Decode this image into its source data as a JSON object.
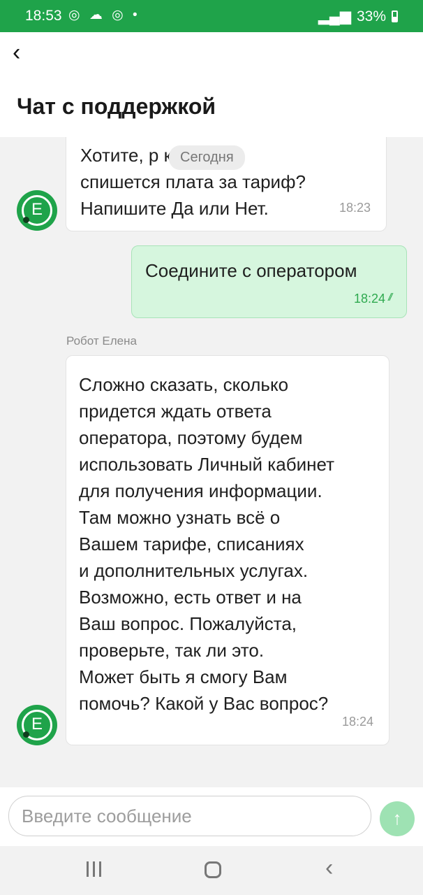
{
  "status_bar": {
    "time": "18:53",
    "left_icons": "◎ ☁ ◎ •",
    "right_text": "33%"
  },
  "header": {
    "title": "Чат с поддержкой"
  },
  "chat": {
    "date_chip": "Сегодня",
    "messages": [
      {
        "direction": "in",
        "text": "Хотите, р          когда\nспишется плата за тариф?\nНапишите Да или Нет.",
        "time": "18:23"
      },
      {
        "direction": "out",
        "text": "Соедините с оператором",
        "time": "18:24"
      },
      {
        "direction": "in",
        "sender": "Робот Елена",
        "text": "Сложно сказать, сколько\nпридется ждать ответа\nоператора, поэтому будем\nиспользовать Личный кабинет\nдля получения информации.\nТам можно узнать всё о\nВашем тарифе, списаниях\nи дополнительных услугах.\nВозможно, есть ответ и на\nВаш вопрос. Пожалуйста,\nпроверьте, так ли это.\nМожет быть я смогу Вам\nпомочь? Какой у Вас вопрос?",
        "time": "18:24"
      }
    ],
    "avatar_letter": "E"
  },
  "input": {
    "placeholder": "Введите сообщение",
    "value": ""
  },
  "colors": {
    "brand": "#1fa34a",
    "outgoing_bubble": "#d6f6de",
    "send_button": "#9ee2b3"
  }
}
